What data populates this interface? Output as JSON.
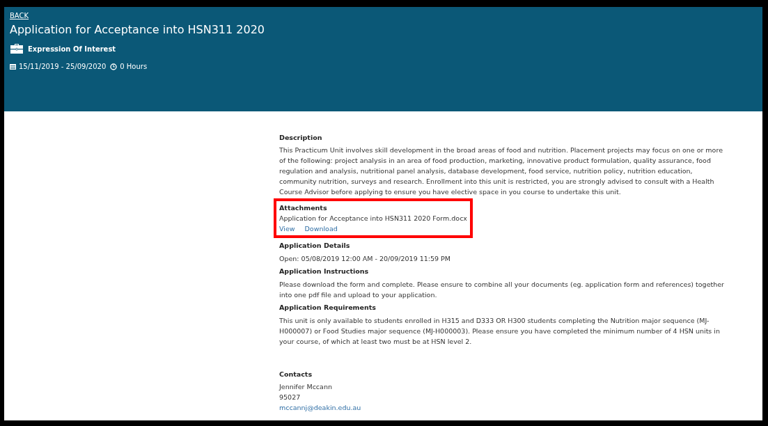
{
  "header": {
    "back_link": "BACK",
    "title": "Application for Acceptance into HSN311 2020",
    "category": "Expression Of Interest",
    "dates": "15/11/2019 - 25/09/2020",
    "hours": "0 Hours"
  },
  "description": {
    "heading": "Description",
    "text": "This Practicum Unit involves skill development in the broad areas of food and nutrition. Placement projects may focus on one or more of the following: project analysis in an area of food production, marketing, innovative product formulation, quality assurance, food regulation and analysis, nutritional panel analysis, database development, food service, nutrition policy, nutrition education, community nutrition, surveys and research. Enrollment into this unit is restricted, you are strongly advised to consult with a Health Course Advisor before applying to ensure you have elective space in you course to undertake this unit."
  },
  "attachments": {
    "heading": "Attachments",
    "highlighted": true,
    "file_name": "Application for Acceptance into HSN311 2020 Form.docx",
    "links": [
      "View",
      "Download"
    ]
  },
  "sections": [
    {
      "heading": "Application Details",
      "text": "Open: 05/08/2019 12:00 AM - 20/09/2019 11:59 PM"
    },
    {
      "heading": "Application Instructions",
      "text": "Please download the form and complete. Please ensure to combine all your documents (eg. application form and references) together into one pdf file and upload to your application."
    },
    {
      "heading": "Application Requirements",
      "text": "This unit is only available to students enrolled in H315 and D333 OR H300 students completing the Nutrition major sequence (MJ-H000007) or Food Studies major sequence (MJ-H000003). Please ensure you have completed the minimum number of 4 HSN units in your course, of which at least two must be at HSN level 2."
    }
  ],
  "contacts": {
    "heading": "Contacts",
    "name": "Jennifer Mccann",
    "phone": "95027",
    "email": "mccannj@deakin.edu.au"
  }
}
